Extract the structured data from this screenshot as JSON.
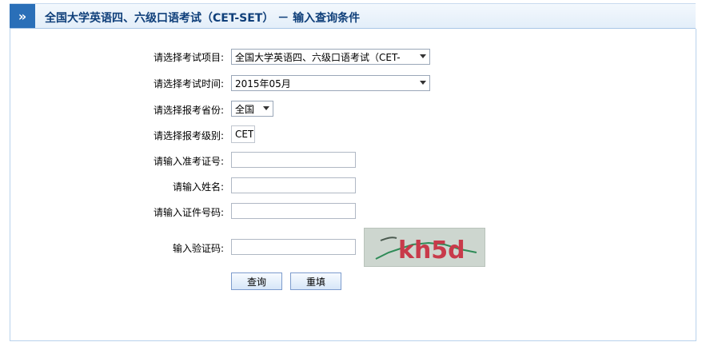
{
  "header": {
    "icon": "double-chevron-right-icon",
    "title": "全国大学英语四、六级口语考试（CET-SET） － 输入查询条件"
  },
  "form": {
    "exam_item_label": "请选择考试项目:",
    "exam_item_value": "全国大学英语四、六级口语考试（CET-",
    "exam_time_label": "请选择考试时间:",
    "exam_time_value": "2015年05月",
    "province_label": "请选择报考省份:",
    "province_value": "全国",
    "level_label": "请选择报考级别:",
    "level_value": "CET",
    "ticket_label": "请输入准考证号:",
    "name_label": "请输入姓名:",
    "id_label": "请输入证件号码:",
    "captcha_label": "输入验证码:",
    "captcha_text": "kh5d"
  },
  "buttons": {
    "query": "查询",
    "reset": "重填"
  }
}
